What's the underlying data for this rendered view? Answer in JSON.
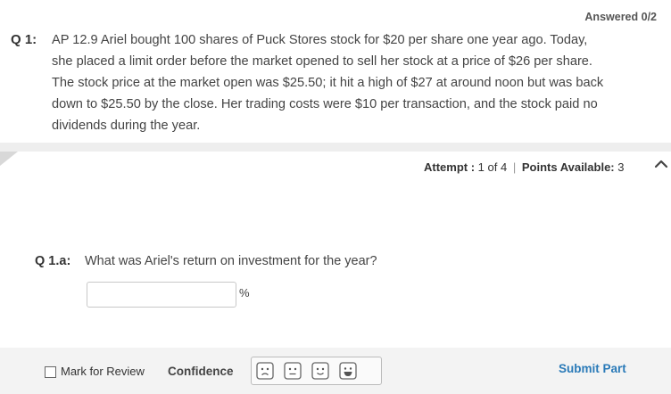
{
  "question": {
    "status": "Answered 0/2",
    "number": "Q 1:",
    "text": "AP 12.9 Ariel bought 100 shares of Puck Stores stock for $20 per share one year ago. Today, she placed a limit order before the market opened to sell her stock at a price of $26 per share. The stock price at the market open was $25.50; it hit a high of $27 at around noon but was back down to $25.50 by the close. Her trading costs were $10 per transaction, and the stock paid no dividends during the year."
  },
  "attempt": {
    "attempt_label": "Attempt :",
    "attempt_value": "1 of 4",
    "separator": "|",
    "points_label": "Points Available:",
    "points_value": "3"
  },
  "part": {
    "label": "Q 1.a:",
    "text": "What was Ariel's return on investment for the year?",
    "answer_value": "",
    "unit": "%"
  },
  "footer": {
    "mark_for_review": "Mark for Review",
    "confidence_label": "Confidence",
    "confidence_levels": [
      "very-unsure-face-icon",
      "neutral-face-icon",
      "smile-face-icon",
      "big-smile-face-icon"
    ],
    "submit": "Submit Part"
  },
  "colors": {
    "link": "#2a7ab8",
    "footer_bg": "#f3f3f3",
    "divider": "#eeeeee"
  }
}
